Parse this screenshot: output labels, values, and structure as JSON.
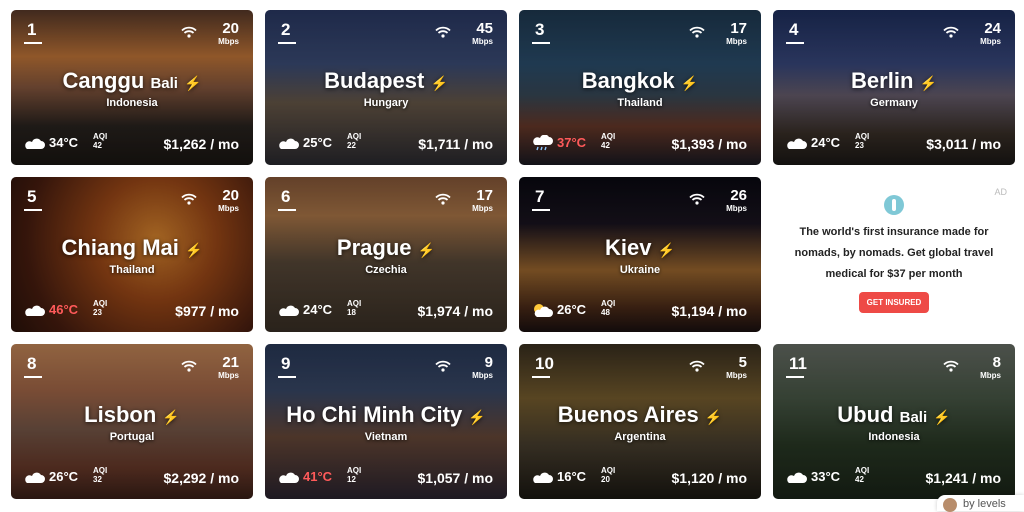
{
  "cities": [
    {
      "rank": "1",
      "name": "Canggu",
      "sub": "Bali",
      "country": "Indonesia",
      "speed": "20",
      "temp": "34°C",
      "temp_hot": false,
      "aqi": "42",
      "cost": "$1,262 / mo",
      "weather": "cloud",
      "bg": "linear-gradient(180deg,#5a3a2a 0%,#c7793a 30%,#8a5a40 50%,#2a2420 75%,#1a1612 100%)"
    },
    {
      "rank": "2",
      "name": "Budapest",
      "sub": "",
      "country": "Hungary",
      "speed": "45",
      "temp": "25°C",
      "temp_hot": false,
      "aqi": "22",
      "cost": "$1,711 / mo",
      "weather": "cloud",
      "bg": "linear-gradient(180deg,#2b3a66 0%,#3d4f7a 35%,#6a5a4a 60%,#2a2a30 100%)"
    },
    {
      "rank": "3",
      "name": "Bangkok",
      "sub": "",
      "country": "Thailand",
      "speed": "17",
      "temp": "37°C",
      "temp_hot": true,
      "aqi": "42",
      "cost": "$1,393 / mo",
      "weather": "rain",
      "bg": "linear-gradient(180deg,#1f3a52 0%,#2c5070 35%,#3a4b5a 55%,#6a3a2a 75%,#1a1a22 100%)"
    },
    {
      "rank": "4",
      "name": "Berlin",
      "sub": "",
      "country": "Germany",
      "speed": "24",
      "temp": "24°C",
      "temp_hot": false,
      "aqi": "23",
      "cost": "$3,011 / mo",
      "weather": "cloud",
      "bg": "linear-gradient(180deg,#1f3060 0%,#3a4a80 35%,#6a6070 55%,#3a3028 80%,#1a1816 100%)"
    },
    {
      "rank": "5",
      "name": "Chiang Mai",
      "sub": "",
      "country": "Thailand",
      "speed": "20",
      "temp": "46°C",
      "temp_hot": true,
      "aqi": "23",
      "cost": "$977 / mo",
      "weather": "cloud",
      "bg": "radial-gradient(circle at 60% 40%,#e08a30 0%,#a04a18 35%,#4a1e10 75%,#2a120a 100%)"
    },
    {
      "rank": "6",
      "name": "Prague",
      "sub": "",
      "country": "Czechia",
      "speed": "17",
      "temp": "24°C",
      "temp_hot": false,
      "aqi": "18",
      "cost": "$1,974 / mo",
      "weather": "cloud",
      "bg": "linear-gradient(180deg,#8a5a3a 0%,#b07a4a 25%,#5a4a3a 55%,#3a3026 100%)"
    },
    {
      "rank": "7",
      "name": "Kiev",
      "sub": "",
      "country": "Ukraine",
      "speed": "26",
      "temp": "26°C",
      "temp_hot": false,
      "aqi": "48",
      "cost": "$1,194 / mo",
      "weather": "sun",
      "bg": "linear-gradient(180deg,#0a0a12 0%,#1a1420 30%,#a06a30 60%,#4a2a18 85%,#1a1010 100%)"
    },
    {
      "rank": "8",
      "name": "Lisbon",
      "sub": "",
      "country": "Portugal",
      "speed": "21",
      "temp": "26°C",
      "temp_hot": false,
      "aqi": "32",
      "cost": "$2,292 / mo",
      "weather": "cloud",
      "bg": "linear-gradient(180deg,#c98a5a 0%,#a86a4a 30%,#7a5a4a 55%,#6a3a2a 80%,#3a2018 100%)"
    },
    {
      "rank": "9",
      "name": "Ho Chi Minh City",
      "sub": "",
      "country": "Vietnam",
      "speed": "9",
      "temp": "41°C",
      "temp_hot": true,
      "aqi": "12",
      "cost": "$1,057 / mo",
      "weather": "cloud",
      "bg": "linear-gradient(180deg,#2a3a5a 0%,#3a4a6a 30%,#6a4a3a 60%,#2a2430 100%)"
    },
    {
      "rank": "10",
      "name": "Buenos Aires",
      "sub": "",
      "country": "Argentina",
      "speed": "5",
      "temp": "16°C",
      "temp_hot": false,
      "aqi": "20",
      "cost": "$1,120 / mo",
      "weather": "cloud",
      "bg": "linear-gradient(180deg,#3a3020 0%,#7a6030 35%,#4a4030 65%,#1a1812 100%)"
    },
    {
      "rank": "11",
      "name": "Ubud",
      "sub": "Bali",
      "country": "Indonesia",
      "speed": "8",
      "temp": "33°C",
      "temp_hot": false,
      "aqi": "42",
      "cost": "$1,241 / mo",
      "weather": "cloud",
      "bg": "linear-gradient(180deg,#6a7068 0%,#4a5a48 35%,#2a3a26 65%,#1a2418 100%)"
    }
  ],
  "labels": {
    "mbps": "Mbps",
    "aqi": "AQI"
  },
  "ad": {
    "label": "AD",
    "text": "The world's first insurance made for nomads, by nomads. Get global travel medical for $37 per month",
    "cta": "GET INSURED"
  },
  "byline": {
    "text": "by levels"
  },
  "colors": {
    "hot_temp": "#ff5a5a",
    "bolt": "#f5c518",
    "cta": "#ee4a46"
  }
}
